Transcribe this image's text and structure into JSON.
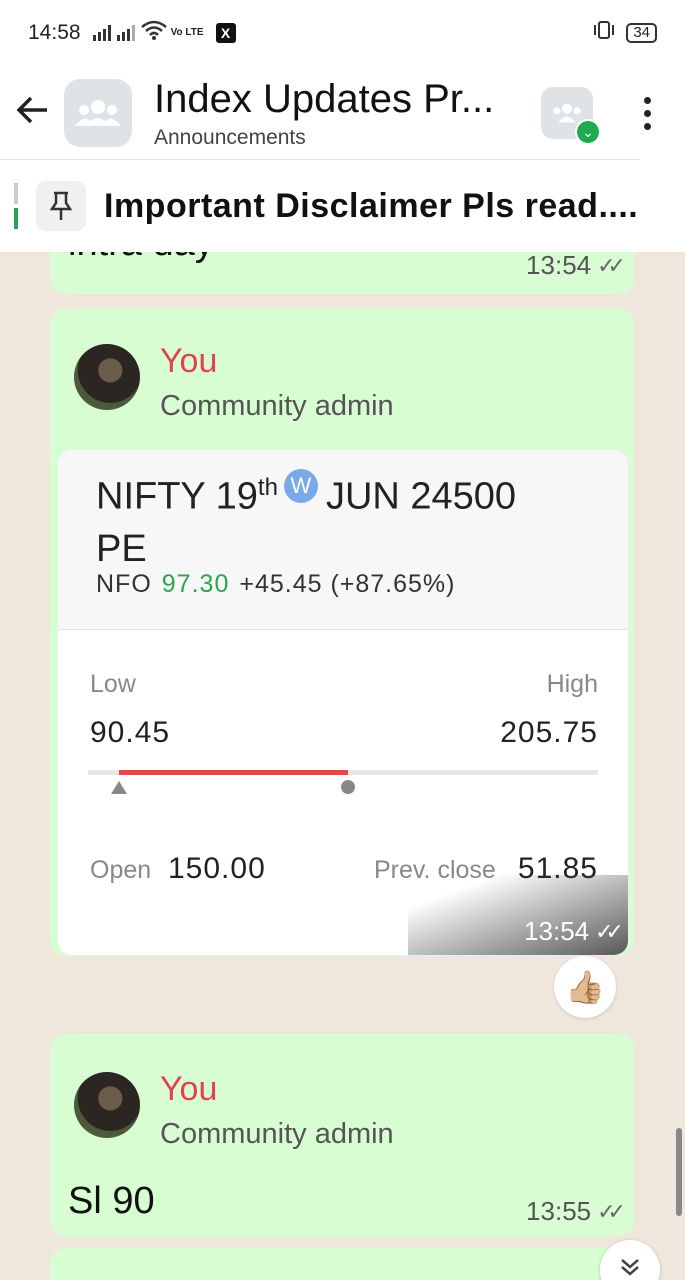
{
  "status_bar": {
    "time": "14:58",
    "volte": "Vo LTE",
    "x_badge": "X",
    "battery": "34"
  },
  "header": {
    "title": "Index Updates Pr...",
    "subtitle": "Announcements"
  },
  "pinned": {
    "text": "Important Disclaimer Pls read...."
  },
  "messages": {
    "prev_text": "intra day",
    "prev_time": "13:54",
    "card_msg": {
      "sender": "You",
      "role": "Community admin",
      "instrument_prefix": "NIFTY 19",
      "instrument_sup": "th",
      "instrument_badge": "W",
      "instrument_suffix": "JUN 24500 PE",
      "exchange": "NFO",
      "ltp": "97.30",
      "change": "+45.45 (+87.65%)",
      "low_label": "Low",
      "high_label": "High",
      "low_value": "90.45",
      "high_value": "205.75",
      "open_label": "Open",
      "open_value": "150.00",
      "prev_close_label": "Prev. close",
      "prev_close_value": "51.85",
      "time": "13:54",
      "range_start_fraction": 0.06,
      "range_end_fraction": 0.51
    },
    "reaction": "👍🏼",
    "text_msg": {
      "sender": "You",
      "role": "Community admin",
      "text": "Sl 90",
      "time": "13:55"
    }
  },
  "colors": {
    "bubble": "#d9fdd3",
    "sender": "#e0434b",
    "ltp_green": "#2ea44f",
    "range_red": "#e04a4a",
    "verified": "#1ea952"
  },
  "icons": [
    "back-arrow-icon",
    "group-icon",
    "community-icon",
    "more-vert-icon",
    "pin-icon",
    "double-tick-icon",
    "chevron-down-icon"
  ]
}
